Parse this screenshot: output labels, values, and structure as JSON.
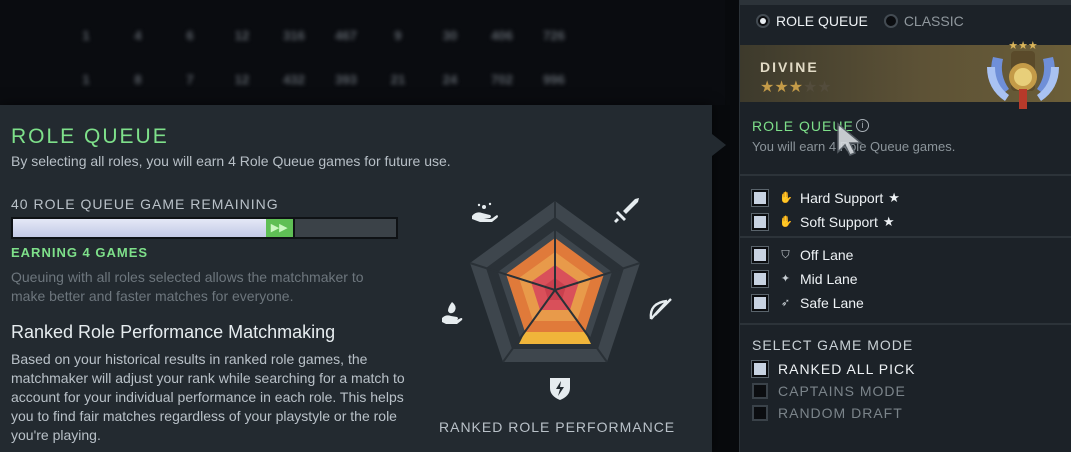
{
  "background_table": {
    "rows": [
      [
        "1",
        "4",
        "6",
        "12",
        "316",
        "467",
        "9",
        "30",
        "406",
        "726"
      ],
      [
        "1",
        "8",
        "7",
        "12",
        "432",
        "393",
        "21",
        "24",
        "702",
        "996"
      ]
    ]
  },
  "tooltip": {
    "title": "ROLE QUEUE",
    "subtitle": "By selecting all roles, you will earn 4 Role Queue games for future use.",
    "remaining_label": "40 ROLE QUEUE GAME REMAINING",
    "progress_fraction": 0.66,
    "earning_fraction": 0.07,
    "earning_glyph": "▶▶",
    "earning_label": "EARNING 4 GAMES",
    "note": "Queuing with all roles selected allows the matchmaker to make better and faster matches for everyone.",
    "matchmaking_title": "Ranked Role Performance Matchmaking",
    "matchmaking_text": "Based on your historical results in ranked role games, the matchmaker will adjust your rank while searching for a match to account for your individual performance in each role. This helps you to find fair matches regardless of your playstyle or the role you're playing.",
    "radar_label": "RANKED ROLE PERFORMANCE",
    "radar_icons": [
      "support-hand-icon",
      "sword-icon",
      "bow-icon",
      "lightning-shield-icon",
      "flame-hand-icon"
    ]
  },
  "panel": {
    "mode_selected": "ROLE QUEUE",
    "mode_other": "CLASSIC",
    "rank_name": "DIVINE",
    "rank_stars_filled": 3,
    "rank_stars_total": 5,
    "rq_title": "ROLE QUEUE",
    "info_glyph": "i",
    "rq_sub": "You will earn 4 Role Queue games.",
    "roles": [
      {
        "label": "Hard Support",
        "icon": "hard-support-icon",
        "glyph": "✋",
        "starred": true,
        "star": "★"
      },
      {
        "label": "Soft Support",
        "icon": "soft-support-icon",
        "glyph": "✋",
        "starred": true,
        "star": "★"
      },
      {
        "label": "Off Lane",
        "icon": "off-lane-icon",
        "glyph": "⛉",
        "starred": false
      },
      {
        "label": "Mid Lane",
        "icon": "mid-lane-icon",
        "glyph": "✦",
        "starred": false
      },
      {
        "label": "Safe Lane",
        "icon": "safe-lane-icon",
        "glyph": "➶",
        "starred": false
      }
    ],
    "select_game_mode": "SELECT GAME MODE",
    "game_modes": [
      {
        "label": "RANKED ALL PICK",
        "checked": true
      },
      {
        "label": "CAPTAINS MODE",
        "checked": false
      },
      {
        "label": "RANDOM DRAFT",
        "checked": false
      }
    ]
  },
  "colors": {
    "accent_green": "#7ee08a",
    "panel_bg": "#1c2228",
    "tooltip_bg": "#232a30",
    "rank_gold": "#c49b48"
  }
}
